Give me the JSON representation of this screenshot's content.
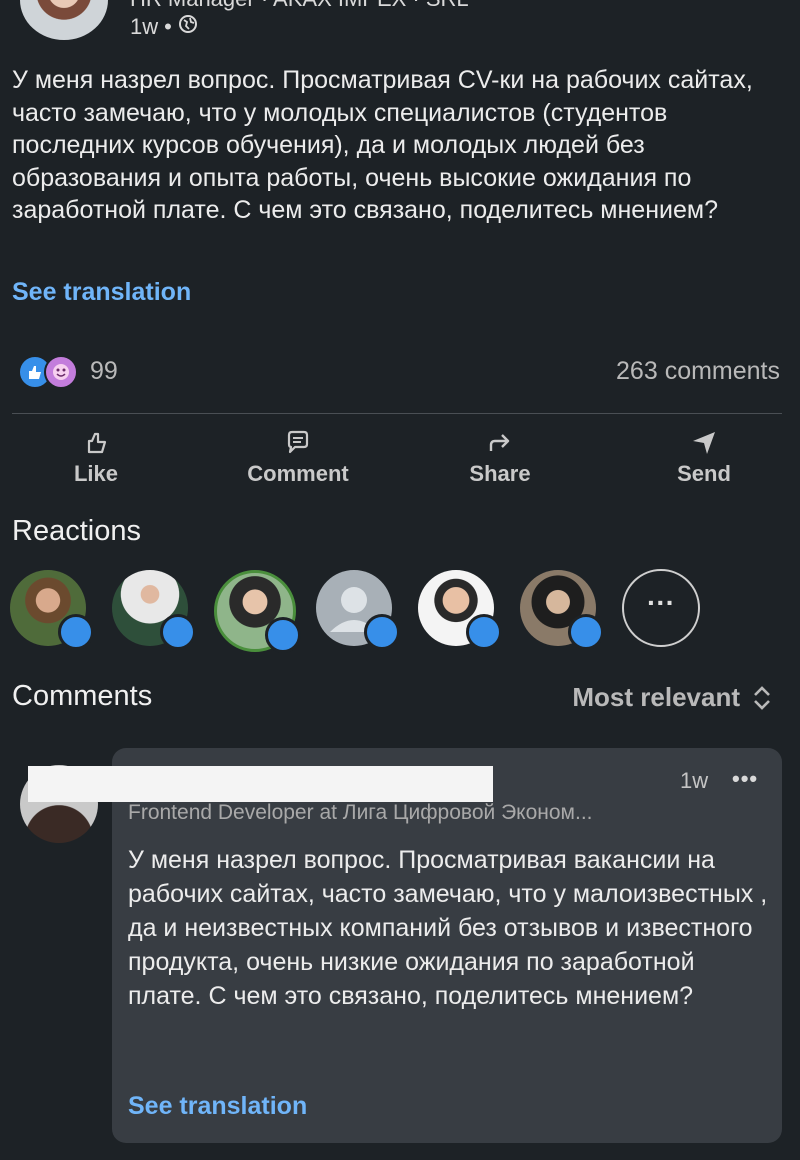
{
  "post": {
    "author_headline": "HR Manager · AKAX IMPEX · SRL",
    "time": "1w",
    "visibility_icon": "globe-icon",
    "text": "У меня назрел вопрос. Просматривая CV-ки на рабочих сайтах, часто замечаю, что у молодых специалистов (студентов последних курсов обучения), да и молодых людей без образования и опыта работы, очень высокие ожидания по заработной плате. С чем это связано, поделитесь мнением?",
    "see_translation": "See translation",
    "reaction_count": "99",
    "comments_count": "263 comments"
  },
  "actions": {
    "like": "Like",
    "comment": "Comment",
    "share": "Share",
    "send": "Send"
  },
  "reactions_section": {
    "title": "Reactions",
    "more": "···"
  },
  "comments_section": {
    "title": "Comments",
    "sort_label": "Most relevant"
  },
  "comment": {
    "time": "1w",
    "more": "•••",
    "headline": "Frontend Developer at Лига Цифровой Эконом...",
    "text": "У меня назрел вопрос. Просматривая вакансии на рабочих сайтах, часто замечаю, что у малоизвестных , да и неизвестных компаний без отзывов и известного продукта, очень низкие ожидания по заработной плате. С чем это связано, поделитесь мнением?",
    "see_translation": "See translation"
  },
  "colors": {
    "background": "#1d2226",
    "link": "#70b5f9",
    "like_blue": "#378fe9",
    "comment_bg": "#383d43"
  }
}
